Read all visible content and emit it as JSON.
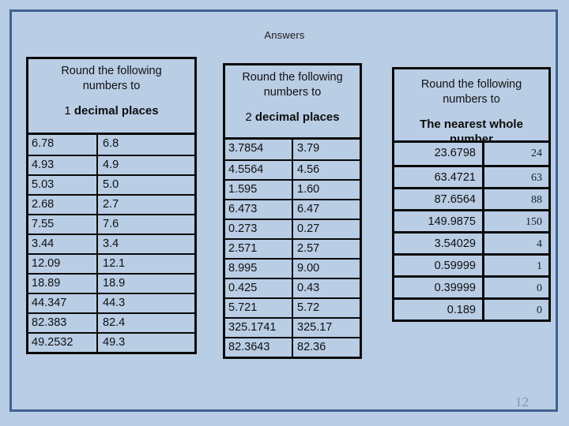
{
  "slide": {
    "title": "Answers",
    "page_number": "12",
    "background_color": "#b9cde5",
    "frame_color": "#40628f"
  },
  "tables": [
    {
      "name": "round-1-decimal-place",
      "header_line1": "Round the following",
      "header_line2": "numbers to",
      "header_emphasis_prefix": "1",
      "header_emphasis": " decimal places",
      "rows": [
        {
          "value": "6.78",
          "answer": "6.8"
        },
        {
          "value": "4.93",
          "answer": "4.9"
        },
        {
          "value": "5.03",
          "answer": "5.0"
        },
        {
          "value": "2.68",
          "answer": "2.7"
        },
        {
          "value": "7.55",
          "answer": "7.6"
        },
        {
          "value": "3.44",
          "answer": "3.4"
        },
        {
          "value": "12.09",
          "answer": "12.1"
        },
        {
          "value": "18.89",
          "answer": "18.9"
        },
        {
          "value": "44.347",
          "answer": "44.3"
        },
        {
          "value": "82.383",
          "answer": "82.4"
        },
        {
          "value": "49.2532",
          "answer": "49.3"
        }
      ]
    },
    {
      "name": "round-2-decimal-places",
      "header_line1": "Round the following",
      "header_line2": "numbers to",
      "header_emphasis_prefix": "2",
      "header_emphasis": " decimal places",
      "rows": [
        {
          "value": "3.7854",
          "answer": "3.79"
        },
        {
          "value": "4.5564",
          "answer": "4.56"
        },
        {
          "value": "1.595",
          "answer": "1.60"
        },
        {
          "value": "6.473",
          "answer": "6.47"
        },
        {
          "value": "0.273",
          "answer": "0.27"
        },
        {
          "value": "2.571",
          "answer": "2.57"
        },
        {
          "value": "8.995",
          "answer": "9.00"
        },
        {
          "value": "0.425",
          "answer": "0.43"
        },
        {
          "value": "5.721",
          "answer": "5.72"
        },
        {
          "value": "325.1741",
          "answer": "325.17"
        },
        {
          "value": "82.3643",
          "answer": "82.36"
        }
      ]
    },
    {
      "name": "round-nearest-whole-number",
      "header_line1": "Round the following",
      "header_line2": "numbers to",
      "header_emphasis_prefix": "",
      "header_emphasis": "The nearest whole number",
      "rows": [
        {
          "value": "23.6798",
          "answer": "24"
        },
        {
          "value": "63.4721",
          "answer": "63"
        },
        {
          "value": "87.6564",
          "answer": "88"
        },
        {
          "value": "149.9875",
          "answer": "150"
        },
        {
          "value": "3.54029",
          "answer": "4"
        },
        {
          "value": "0.59999",
          "answer": "1"
        },
        {
          "value": "0.39999",
          "answer": "0"
        },
        {
          "value": "0.189",
          "answer": "0"
        }
      ]
    }
  ]
}
